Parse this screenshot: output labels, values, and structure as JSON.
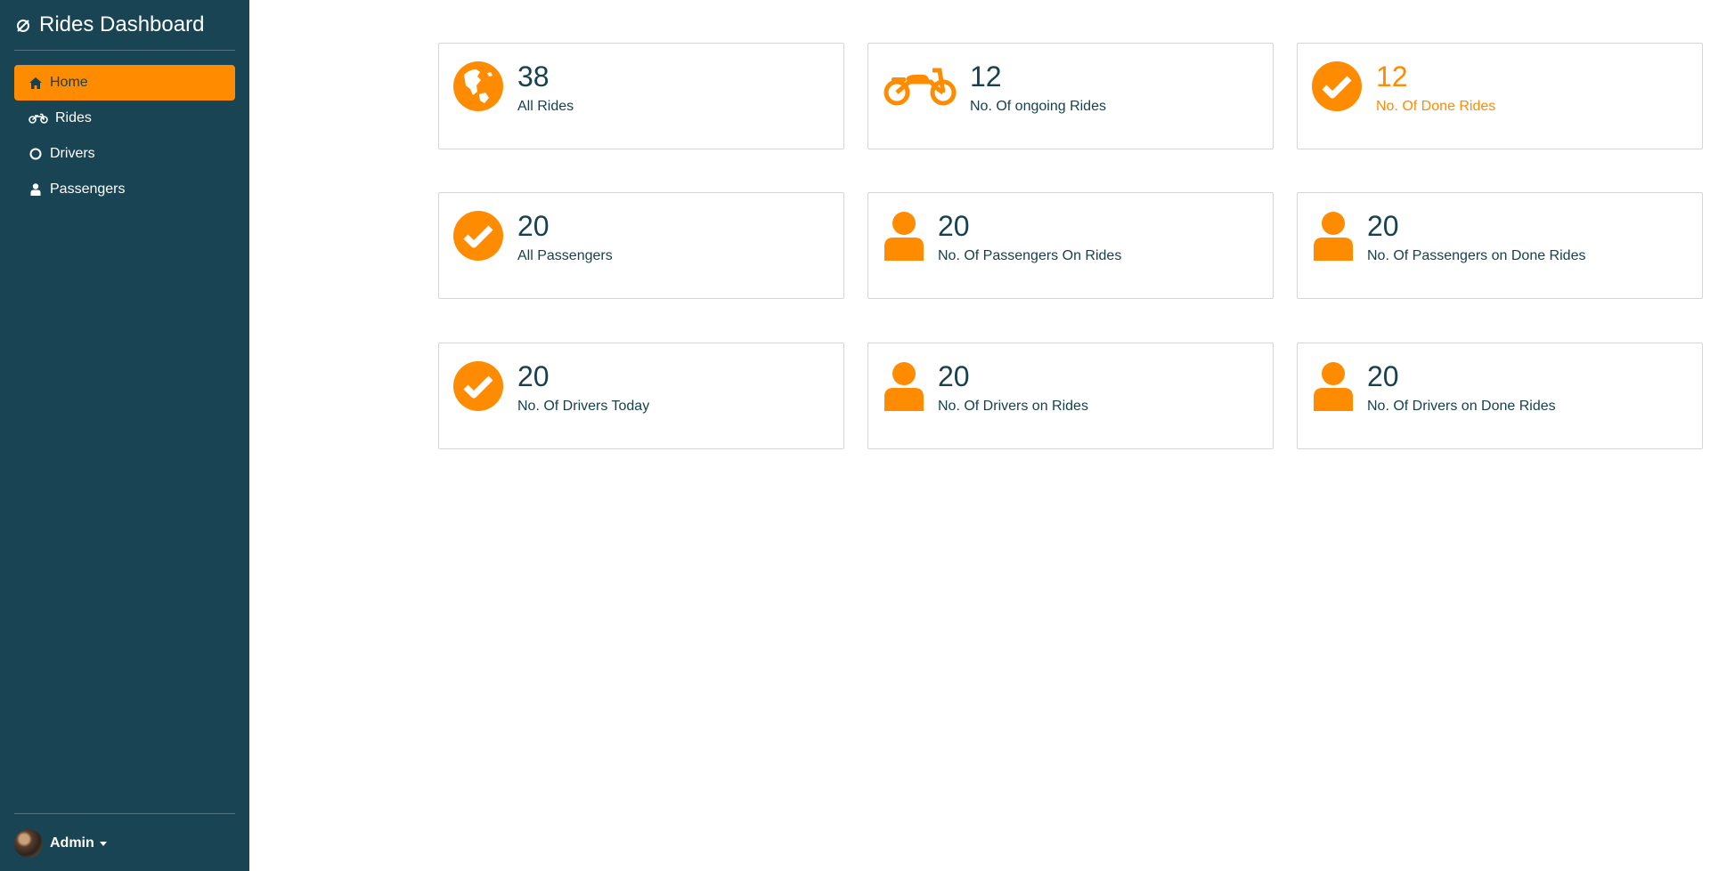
{
  "sidebar": {
    "brand": "Rides Dashboard",
    "items": [
      {
        "label": "Home",
        "icon": "home-icon",
        "active": true
      },
      {
        "label": "Rides",
        "icon": "motorcycle-icon",
        "active": false
      },
      {
        "label": "Drivers",
        "icon": "circle-icon",
        "active": false
      },
      {
        "label": "Passengers",
        "icon": "user-icon",
        "active": false
      }
    ],
    "user": {
      "name": "Admin"
    }
  },
  "colors": {
    "sidebar_bg": "#184453",
    "accent": "#ff8c00",
    "text": "#17414f"
  },
  "cards": [
    {
      "value": "38",
      "label": "All Rides",
      "icon": "globe-icon"
    },
    {
      "value": "12",
      "label": "No. Of ongoing Rides",
      "icon": "motorcycle-icon"
    },
    {
      "value": "12",
      "label": "No. Of Done Rides",
      "icon": "check-circle-icon",
      "highlight": true
    },
    {
      "value": "20",
      "label": "All Passengers",
      "icon": "check-circle-icon"
    },
    {
      "value": "20",
      "label": "No. Of Passengers On Rides",
      "icon": "user-icon"
    },
    {
      "value": "20",
      "label": "No. Of Passengers on Done Rides",
      "icon": "user-icon"
    },
    {
      "value": "20",
      "label": "No. Of Drivers Today",
      "icon": "check-circle-icon"
    },
    {
      "value": "20",
      "label": "No. Of Drivers on Rides",
      "icon": "user-icon"
    },
    {
      "value": "20",
      "label": "No. Of Drivers on Done Rides",
      "icon": "user-icon"
    }
  ]
}
